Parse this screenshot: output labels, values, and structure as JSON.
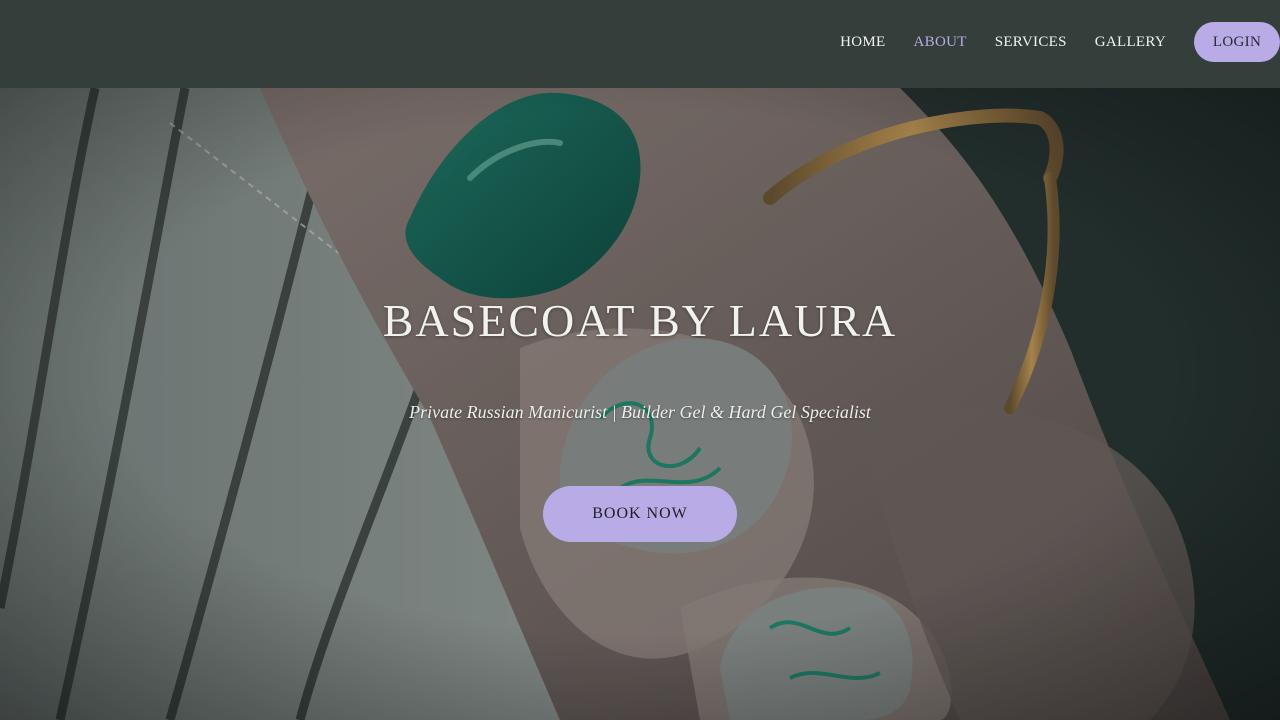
{
  "nav": {
    "items": [
      {
        "label": "HOME",
        "active": false
      },
      {
        "label": "ABOUT",
        "active": true
      },
      {
        "label": "SERVICES",
        "active": false
      },
      {
        "label": "GALLERY",
        "active": false
      }
    ],
    "login_label": "LOGIN"
  },
  "hero": {
    "title": "BASECOAT BY LAURA",
    "subtitle": "Private Russian Manicurist | Builder Gel & Hard Gel Specialist",
    "cta_label": "BOOK NOW",
    "image": "hand-with-green-manicured-nails-photo"
  },
  "colors": {
    "header_bg": "#343e3b",
    "accent": "#b9abe6",
    "active_nav": "#b9abe6",
    "nail_green": "#0f5a4c"
  }
}
